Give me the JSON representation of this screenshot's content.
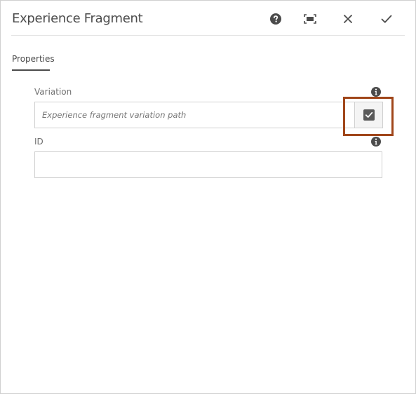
{
  "dialog": {
    "title": "Experience Fragment",
    "header_icons": [
      "help-icon",
      "fullscreen-icon",
      "close-icon",
      "checkmark-icon"
    ]
  },
  "tabs": [
    {
      "label": "Properties",
      "active": true
    }
  ],
  "fields": {
    "variation": {
      "label": "Variation",
      "placeholder": "Experience fragment variation path",
      "value": "",
      "info_icon": "info-icon",
      "picker_icon": "select-checkbox-icon"
    },
    "id": {
      "label": "ID",
      "value": "",
      "info_icon": "info-icon"
    }
  },
  "colors": {
    "highlight": "#a0461a",
    "text": "#4b4b4b",
    "border": "#d0d0d0"
  }
}
